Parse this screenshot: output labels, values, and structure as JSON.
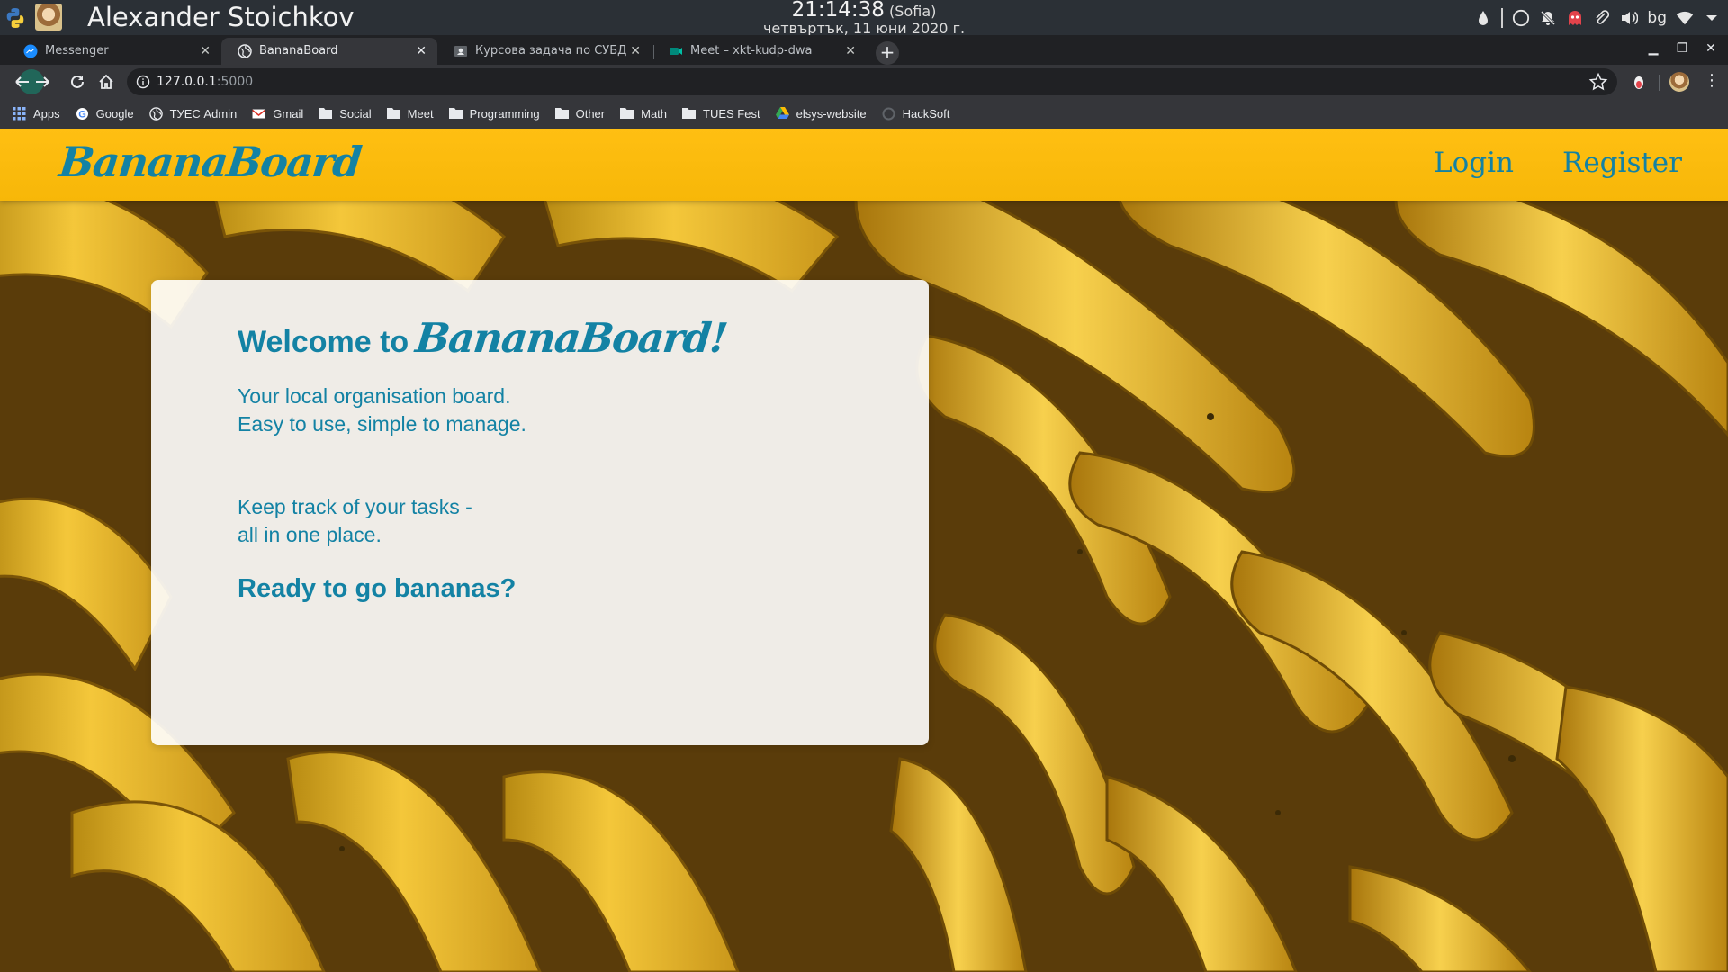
{
  "os_panel": {
    "window_title": "Alexander Stoichkov",
    "clock_time": "21:14:38",
    "clock_tz": "(Sofia)",
    "clock_date": "четвъртък, 11 юни 2020 г.",
    "language": "bg",
    "tray_icons": [
      "droplet-icon",
      "circle-icon",
      "bell-off-icon",
      "pacman-ghost-icon",
      "paperclip-icon",
      "volume-icon",
      "wifi-icon",
      "chevron-down-icon"
    ]
  },
  "browser": {
    "tabs": [
      {
        "title": "Messenger",
        "icon": "messenger-icon",
        "active": false
      },
      {
        "title": "BananaBoard",
        "icon": "globe-icon",
        "active": true
      },
      {
        "title": "Курсова задача по СУБД",
        "icon": "classroom-icon",
        "active": false
      },
      {
        "title": "Meet – xkt-kudp-dwa",
        "icon": "meet-icon",
        "active": false
      }
    ],
    "new_tab_label": "+",
    "url_host": "127.0.0.1",
    "url_port": ":5000",
    "bookmarks": [
      {
        "label": "Apps",
        "icon": "apps-grid-icon"
      },
      {
        "label": "Google",
        "icon": "google-icon"
      },
      {
        "label": "ТУЕС Admin",
        "icon": "globe-icon"
      },
      {
        "label": "Gmail",
        "icon": "gmail-icon"
      },
      {
        "label": "Social",
        "icon": "folder-icon"
      },
      {
        "label": "Meet",
        "icon": "folder-icon"
      },
      {
        "label": "Programming",
        "icon": "folder-icon"
      },
      {
        "label": "Other",
        "icon": "folder-icon"
      },
      {
        "label": "Math",
        "icon": "folder-icon"
      },
      {
        "label": "TUES Fest",
        "icon": "folder-icon"
      },
      {
        "label": "elsys-website",
        "icon": "drive-icon"
      },
      {
        "label": "HackSoft",
        "icon": "hacksoft-icon"
      }
    ]
  },
  "site": {
    "brand": "BananaBoard",
    "nav": {
      "login": "Login",
      "register": "Register"
    },
    "welcome": {
      "heading_prefix": "Welcome to",
      "heading_brand": "BananaBoard!",
      "line1": "Your local organisation board.",
      "line2": "Easy to use, simple to manage.",
      "line3": "Keep track of your tasks -",
      "line4": "all in one place.",
      "cta": "Ready to go bananas?"
    },
    "colors": {
      "nav_bg": "#ffbf12",
      "brand_text": "#1382a4",
      "card_bg": "#ffffff"
    }
  }
}
